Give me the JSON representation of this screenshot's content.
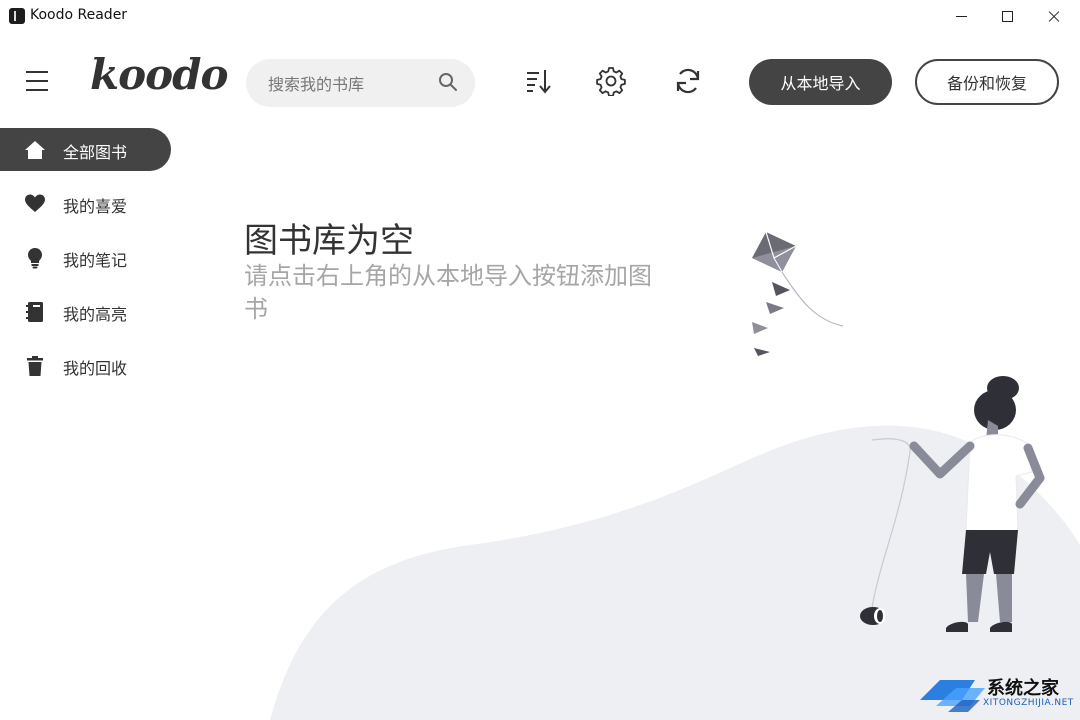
{
  "window": {
    "title": "Koodo Reader"
  },
  "header": {
    "logo_text": "koodo",
    "search_placeholder": "搜索我的书库",
    "import_label": "从本地导入",
    "backup_label": "备份和恢复"
  },
  "sidebar": {
    "items": [
      {
        "label": "全部图书",
        "icon": "home-icon",
        "active": true
      },
      {
        "label": "我的喜爱",
        "icon": "heart-icon",
        "active": false
      },
      {
        "label": "我的笔记",
        "icon": "bulb-icon",
        "active": false
      },
      {
        "label": "我的高亮",
        "icon": "notebook-icon",
        "active": false
      },
      {
        "label": "我的回收",
        "icon": "trash-icon",
        "active": false
      }
    ]
  },
  "empty": {
    "title": "图书库为空",
    "subtitle": "请点击右上角的从本地导入按钮添加图书"
  },
  "watermark": {
    "text": "系统之家",
    "url": "XITONGZHIJIA.NET"
  },
  "colors": {
    "accent": "#444444",
    "muted_text": "#a6a6a6",
    "hill": "#eeeff2"
  }
}
